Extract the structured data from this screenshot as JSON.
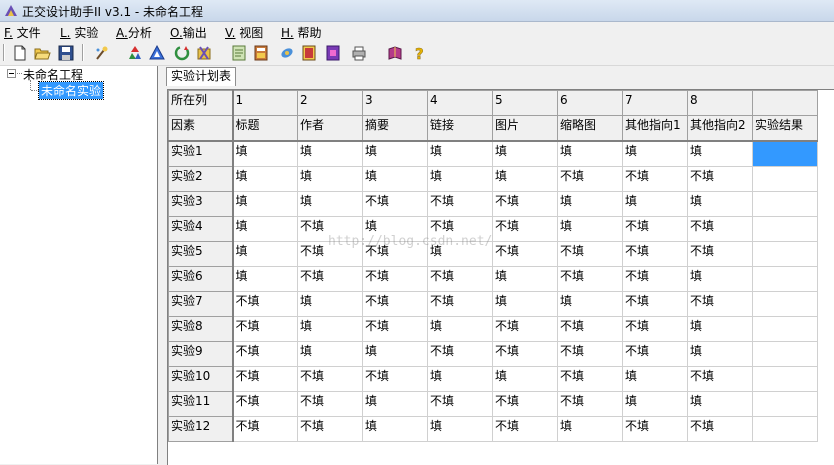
{
  "window": {
    "title": "正交设计助手II v3.1 - 未命名工程"
  },
  "menu": [
    {
      "key": "F.",
      "label": " 文件"
    },
    {
      "key": "L.",
      "label": " 实验"
    },
    {
      "key": "A.",
      "label": "分析"
    },
    {
      "key": "O.",
      "label": "输出"
    },
    {
      "key": "V.",
      "label": " 视图"
    },
    {
      "key": "H.",
      "label": " 帮助"
    }
  ],
  "toolbar": {
    "icons": [
      "new-file-icon",
      "open-folder-icon",
      "save-icon",
      "wizard-icon",
      "recycle-icon",
      "triangle-icon",
      "refresh-icon",
      "clear-icon",
      "notes-icon",
      "calculator-icon",
      "analysis-icon",
      "table-icon",
      "report-icon",
      "print-icon",
      "book-icon",
      "help-icon"
    ]
  },
  "tree": {
    "root": "未命名工程",
    "child": "未命名实验"
  },
  "tabs": [
    "实验计划表"
  ],
  "grid": {
    "row_col_label": "所在列",
    "row_factor_label": "因素",
    "col_numbers": [
      "1",
      "2",
      "3",
      "4",
      "5",
      "6",
      "7",
      "8",
      ""
    ],
    "factors": [
      "标题",
      "作者",
      "摘要",
      "链接",
      "图片",
      "缩略图",
      "其他指向1",
      "其他指向2",
      "实验结果"
    ],
    "rows": [
      {
        "name": "实验1",
        "cells": [
          "填",
          "填",
          "填",
          "填",
          "填",
          "填",
          "填",
          "填",
          ""
        ]
      },
      {
        "name": "实验2",
        "cells": [
          "填",
          "填",
          "填",
          "填",
          "填",
          "不填",
          "不填",
          "不填",
          ""
        ]
      },
      {
        "name": "实验3",
        "cells": [
          "填",
          "填",
          "不填",
          "不填",
          "不填",
          "填",
          "填",
          "填",
          ""
        ]
      },
      {
        "name": "实验4",
        "cells": [
          "填",
          "不填",
          "填",
          "不填",
          "不填",
          "填",
          "不填",
          "不填",
          ""
        ]
      },
      {
        "name": "实验5",
        "cells": [
          "填",
          "不填",
          "不填",
          "填",
          "不填",
          "不填",
          "不填",
          "不填",
          ""
        ]
      },
      {
        "name": "实验6",
        "cells": [
          "填",
          "不填",
          "不填",
          "不填",
          "填",
          "不填",
          "不填",
          "填",
          ""
        ]
      },
      {
        "name": "实验7",
        "cells": [
          "不填",
          "填",
          "不填",
          "不填",
          "填",
          "填",
          "不填",
          "不填",
          ""
        ]
      },
      {
        "name": "实验8",
        "cells": [
          "不填",
          "填",
          "不填",
          "填",
          "不填",
          "不填",
          "不填",
          "填",
          ""
        ]
      },
      {
        "name": "实验9",
        "cells": [
          "不填",
          "填",
          "填",
          "不填",
          "不填",
          "不填",
          "不填",
          "填",
          ""
        ]
      },
      {
        "name": "实验10",
        "cells": [
          "不填",
          "不填",
          "不填",
          "填",
          "填",
          "不填",
          "填",
          "不填",
          ""
        ]
      },
      {
        "name": "实验11",
        "cells": [
          "不填",
          "不填",
          "填",
          "不填",
          "不填",
          "不填",
          "填",
          "填",
          ""
        ]
      },
      {
        "name": "实验12",
        "cells": [
          "不填",
          "不填",
          "填",
          "填",
          "不填",
          "填",
          "不填",
          "不填",
          ""
        ]
      }
    ]
  },
  "watermark": "http://blog.csdn.net/",
  "colors": {
    "selection": "#3399ff",
    "fixed_cell": "#f0f0f0",
    "grid_line": "#d0d0d0"
  }
}
